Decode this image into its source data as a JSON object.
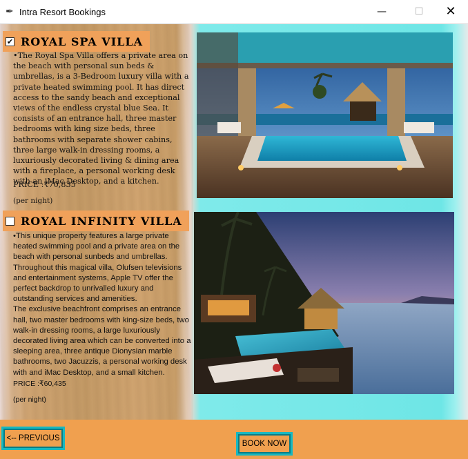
{
  "window": {
    "title": "Intra Resort Bookings"
  },
  "villas": [
    {
      "checked": true,
      "check_glyph": "✔",
      "name": "ROYAL SPA VILLA",
      "description": "•The Royal Spa Villa offers a private area on the beach with personal sun beds & umbrellas, is a 3-Bedroom luxury villa with a private heated swimming pool. It has direct access to the sandy beach and exceptional views of the endless crystal blue Sea. It consists of an entrance hall, three master bedrooms with king size beds, three bathrooms with separate shower cabins, three large walk-in dressing rooms, a luxuriously decorated living & dining area with a fireplace, a personal working desk with an iMac Desktop, and a kitchen.",
      "price": "PRICE :₹70,835",
      "per_night": "(per night)"
    },
    {
      "checked": false,
      "check_glyph": "",
      "name": "ROYAL INFINITY VILLA",
      "description": "•This unique property features a large private heated swimming pool and a private area on the beach with personal sunbeds and umbrellas. Throughout this magical villa, Olufsen televisions and entertainment systems, Apple TV offer the perfect backdrop to unrivalled luxury and outstanding services and amenities.\nThe exclusive beachfront comprises an entrance hall, two master bedrooms with king-size beds, two walk-in dressing rooms, a large luxuriously decorated living area which can be converted into a sleeping area, three antique Dionysian marble bathrooms, two Jacuzzis, a personal working desk with and iMac Desktop, and a small kitchen.",
      "price": "PRICE :₹60,435",
      "per_night": "(per night)"
    }
  ],
  "buttons": {
    "previous": "<-- PREVIOUS",
    "book_now": "BOOK NOW"
  },
  "colors": {
    "accent": "#f0a15a",
    "button_border": "#18b8c0",
    "glow": "#6ee6e6"
  }
}
